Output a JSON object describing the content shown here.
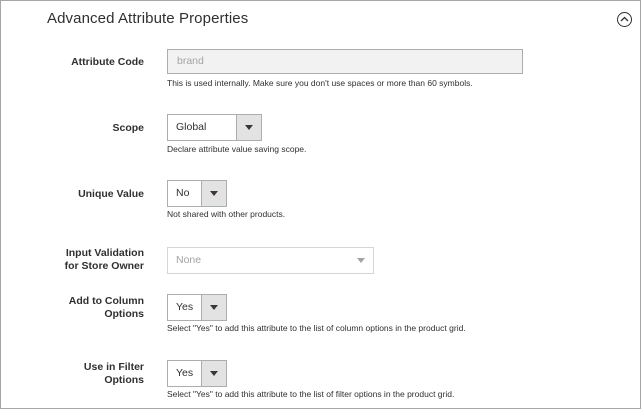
{
  "section": {
    "title": "Advanced Attribute Properties",
    "collapse_icon": "collapse-chevron-up-icon"
  },
  "fields": {
    "attribute_code": {
      "label": "Attribute Code",
      "value": "brand",
      "note": "This is used internally. Make sure you don't use spaces or more than 60 symbols."
    },
    "scope": {
      "label": "Scope",
      "value": "Global",
      "note": "Declare attribute value saving scope."
    },
    "unique_value": {
      "label": "Unique Value",
      "value": "No",
      "note": "Not shared with other products."
    },
    "input_validation": {
      "label_line1": "Input Validation",
      "label_line2": "for Store Owner",
      "value": "None"
    },
    "add_to_column_options": {
      "label_line1": "Add to Column",
      "label_line2": "Options",
      "value": "Yes",
      "note": "Select \"Yes\" to add this attribute to the list of column options in the product grid."
    },
    "use_in_filter_options": {
      "label_line1": "Use in Filter",
      "label_line2": "Options",
      "value": "Yes",
      "note": "Select \"Yes\" to add this attribute to the list of filter options in the product grid."
    }
  }
}
